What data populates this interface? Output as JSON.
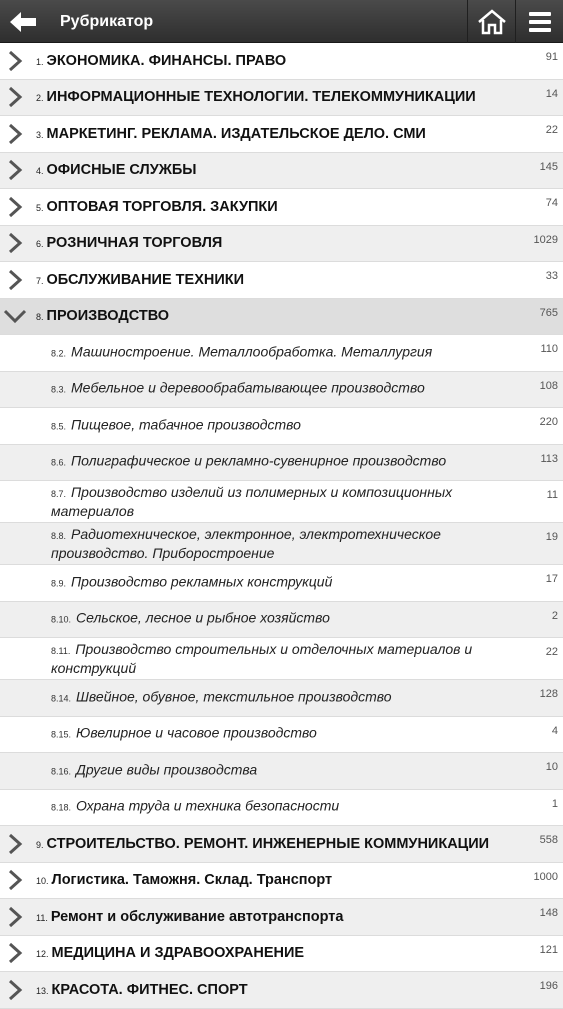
{
  "header": {
    "title": "Рубрикатор",
    "back_icon": "arrow-left-icon",
    "home_icon": "home-icon",
    "menu_icon": "hamburger-menu-icon"
  },
  "categories_top": [
    {
      "num": "1.",
      "label": "ЭКОНОМИКА. ФИНАНСЫ. ПРАВО",
      "count": "91"
    },
    {
      "num": "2.",
      "label": "ИНФОРМАЦИОННЫЕ ТЕХНОЛОГИИ. ТЕЛЕКОММУНИКАЦИИ",
      "count": "14"
    },
    {
      "num": "3.",
      "label": "МАРКЕТИНГ. РЕКЛАМА. ИЗДАТЕЛЬСКОЕ ДЕЛО. СМИ",
      "count": "22"
    },
    {
      "num": "4.",
      "label": "ОФИСНЫЕ СЛУЖБЫ",
      "count": "145"
    },
    {
      "num": "5.",
      "label": "ОПТОВАЯ ТОРГОВЛЯ. ЗАКУПКИ",
      "count": "74"
    },
    {
      "num": "6.",
      "label": "РОЗНИЧНАЯ ТОРГОВЛЯ",
      "count": "1029"
    },
    {
      "num": "7.",
      "label": "ОБСЛУЖИВАНИЕ ТЕХНИКИ",
      "count": "33"
    }
  ],
  "expanded": {
    "num": "8.",
    "label": "ПРОИЗВОДСТВО",
    "count": "765"
  },
  "subcategories": [
    {
      "num": "8.2.",
      "label": "Машиностроение. Металлообработка. Металлургия",
      "count": "110"
    },
    {
      "num": "8.3.",
      "label": "Мебельное и деревообрабатывающее производство",
      "count": "108"
    },
    {
      "num": "8.5.",
      "label": "Пищевое, табачное производство",
      "count": "220"
    },
    {
      "num": "8.6.",
      "label": "Полиграфическое и рекламно-сувенирное производство",
      "count": "113"
    },
    {
      "num": "8.7.",
      "label": "Производство изделий из полимерных и композиционных материалов",
      "count": "11"
    },
    {
      "num": "8.8.",
      "label": "Радиотехническое, электронное, электротехническое производство. Приборостроение",
      "count": "19"
    },
    {
      "num": "8.9.",
      "label": "Производство рекламных конструкций",
      "count": "17"
    },
    {
      "num": "8.10.",
      "label": "Сельское, лесное и рыбное хозяйство",
      "count": "2"
    },
    {
      "num": "8.11.",
      "label": "Производство строительных и отделочных  материалов и конструкций",
      "count": "22"
    },
    {
      "num": "8.14.",
      "label": "Швейное, обувное, текстильное производство",
      "count": "128"
    },
    {
      "num": "8.15.",
      "label": "Ювелирное и часовое производство",
      "count": "4"
    },
    {
      "num": "8.16.",
      "label": "Другие виды производства",
      "count": "10"
    },
    {
      "num": "8.18.",
      "label": "Охрана труда и техника безопасности",
      "count": "1"
    }
  ],
  "categories_bottom": [
    {
      "num": "9.",
      "label": "СТРОИТЕЛЬСТВО. РЕМОНТ. ИНЖЕНЕРНЫЕ КОММУНИКАЦИИ",
      "count": "558"
    },
    {
      "num": "10.",
      "label": "Логистика. Таможня. Склад. Транспорт",
      "count": "1000"
    },
    {
      "num": "11.",
      "label": "Ремонт и обслуживание автотранспорта",
      "count": "148"
    },
    {
      "num": "12.",
      "label": "МЕДИЦИНА И ЗДРАВООХРАНЕНИЕ",
      "count": "121"
    },
    {
      "num": "13.",
      "label": "КРАСОТА. ФИТНЕС. СПОРТ",
      "count": "196"
    }
  ]
}
